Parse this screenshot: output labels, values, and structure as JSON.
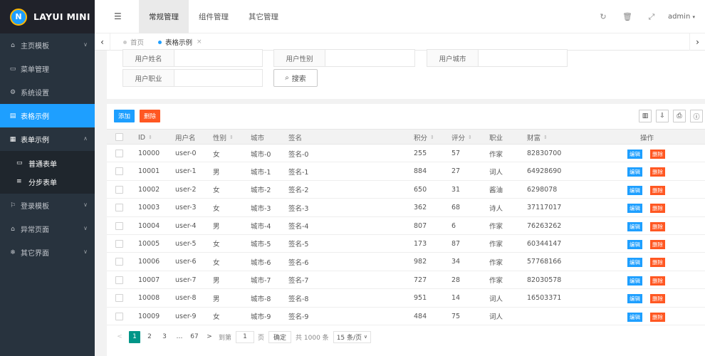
{
  "sidebar": {
    "logo_text": "LAYUI MINI",
    "logo_letter": "N",
    "items": [
      {
        "label": "主页模板",
        "icon": "home-icon"
      },
      {
        "label": "菜单管理",
        "icon": "window-icon"
      },
      {
        "label": "系统设置",
        "icon": "gears-icon"
      },
      {
        "label": "表格示例",
        "icon": "file-icon"
      },
      {
        "label": "表单示例",
        "icon": "calendar-icon"
      },
      {
        "label": "登录模板",
        "icon": "flag-icon"
      },
      {
        "label": "异常页面",
        "icon": "home-icon"
      },
      {
        "label": "其它界面",
        "icon": "snowflake-icon"
      }
    ],
    "sub_items": [
      {
        "label": "普通表单",
        "icon": "list-alt-icon"
      },
      {
        "label": "分步表单",
        "icon": "bars-icon"
      }
    ]
  },
  "header": {
    "nav": [
      "常规管理",
      "组件管理",
      "其它管理"
    ],
    "user": "admin"
  },
  "tabs": [
    "首页",
    "表格示例"
  ],
  "search": {
    "fields": [
      "用户姓名",
      "用户性别",
      "用户城市",
      "用户职业"
    ],
    "button": "搜索"
  },
  "toolbar": {
    "add": "添加",
    "delete": "删除"
  },
  "table": {
    "columns": {
      "id": "ID",
      "username": "用户名",
      "sex": "性别",
      "city": "城市",
      "sign": "签名",
      "experience": "积分",
      "score": "评分",
      "classify": "职业",
      "wealth": "财富",
      "ops": "操作"
    },
    "edit_label": "编辑",
    "delete_label": "删除",
    "rows": [
      [
        "10000",
        "user-0",
        "女",
        "城市-0",
        "签名-0",
        "255",
        "57",
        "作家",
        "82830700"
      ],
      [
        "10001",
        "user-1",
        "男",
        "城市-1",
        "签名-1",
        "884",
        "27",
        "词人",
        "64928690"
      ],
      [
        "10002",
        "user-2",
        "女",
        "城市-2",
        "签名-2",
        "650",
        "31",
        "酱油",
        "6298078"
      ],
      [
        "10003",
        "user-3",
        "女",
        "城市-3",
        "签名-3",
        "362",
        "68",
        "诗人",
        "37117017"
      ],
      [
        "10004",
        "user-4",
        "男",
        "城市-4",
        "签名-4",
        "807",
        "6",
        "作家",
        "76263262"
      ],
      [
        "10005",
        "user-5",
        "女",
        "城市-5",
        "签名-5",
        "173",
        "87",
        "作家",
        "60344147"
      ],
      [
        "10006",
        "user-6",
        "女",
        "城市-6",
        "签名-6",
        "982",
        "34",
        "作家",
        "57768166"
      ],
      [
        "10007",
        "user-7",
        "男",
        "城市-7",
        "签名-7",
        "727",
        "28",
        "作家",
        "82030578"
      ],
      [
        "10008",
        "user-8",
        "男",
        "城市-8",
        "签名-8",
        "951",
        "14",
        "词人",
        "16503371"
      ],
      [
        "10009",
        "user-9",
        "女",
        "城市-9",
        "签名-9",
        "484",
        "75",
        "词人",
        ""
      ]
    ]
  },
  "pager": {
    "prev": "<",
    "pages": [
      "1",
      "2",
      "3",
      "…",
      "67"
    ],
    "next": ">",
    "goto_label": "到第",
    "goto_value": "1",
    "page_unit": "页",
    "confirm": "确定",
    "total": "共 1000 条",
    "per_page": "15 条/页"
  },
  "colors": {
    "accent": "#1e9fff",
    "danger": "#ff5722",
    "pager_current": "#009688",
    "sidebar_bg": "#28333e"
  }
}
